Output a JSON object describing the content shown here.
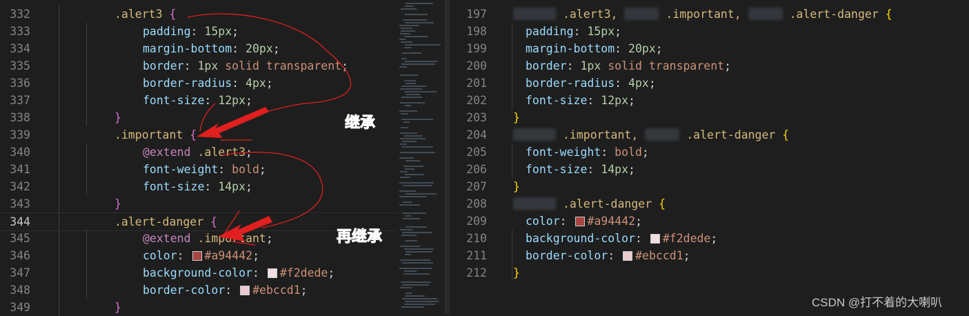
{
  "left_editor": {
    "current_line": 344,
    "lines": [
      {
        "n": "332",
        "indent": 1,
        "tokens": [
          [
            ".alert3 ",
            "sel"
          ],
          [
            "{",
            "bo"
          ]
        ]
      },
      {
        "n": "333",
        "indent": 2,
        "tokens": [
          [
            "padding",
            "prop"
          ],
          [
            ": ",
            "p"
          ],
          [
            "15px",
            "num"
          ],
          [
            ";",
            "p"
          ]
        ]
      },
      {
        "n": "334",
        "indent": 2,
        "tokens": [
          [
            "margin-bottom",
            "prop"
          ],
          [
            ": ",
            "p"
          ],
          [
            "20px",
            "num"
          ],
          [
            ";",
            "p"
          ]
        ]
      },
      {
        "n": "335",
        "indent": 2,
        "tokens": [
          [
            "border",
            "prop"
          ],
          [
            ": ",
            "p"
          ],
          [
            "1px",
            "num"
          ],
          [
            " solid transparent",
            "str"
          ],
          [
            ";",
            "p"
          ]
        ]
      },
      {
        "n": "336",
        "indent": 2,
        "tokens": [
          [
            "border-radius",
            "prop"
          ],
          [
            ": ",
            "p"
          ],
          [
            "4px",
            "num"
          ],
          [
            ";",
            "p"
          ]
        ]
      },
      {
        "n": "337",
        "indent": 2,
        "tokens": [
          [
            "font-size",
            "prop"
          ],
          [
            ": ",
            "p"
          ],
          [
            "12px",
            "num"
          ],
          [
            ";",
            "p"
          ]
        ]
      },
      {
        "n": "338",
        "indent": 1,
        "tokens": [
          [
            "}",
            "bo"
          ]
        ]
      },
      {
        "n": "339",
        "indent": 1,
        "tokens": [
          [
            ".important ",
            "sel"
          ],
          [
            "{",
            "bo"
          ]
        ]
      },
      {
        "n": "340",
        "indent": 2,
        "tokens": [
          [
            "@extend",
            "at"
          ],
          [
            " .alert3",
            "sel"
          ],
          [
            ";",
            "p"
          ]
        ]
      },
      {
        "n": "341",
        "indent": 2,
        "tokens": [
          [
            "font-weight",
            "prop"
          ],
          [
            ": ",
            "p"
          ],
          [
            "bold",
            "str"
          ],
          [
            ";",
            "p"
          ]
        ]
      },
      {
        "n": "342",
        "indent": 2,
        "tokens": [
          [
            "font-size",
            "prop"
          ],
          [
            ": ",
            "p"
          ],
          [
            "14px",
            "num"
          ],
          [
            ";",
            "p"
          ]
        ]
      },
      {
        "n": "343",
        "indent": 1,
        "tokens": [
          [
            "}",
            "bo"
          ]
        ]
      },
      {
        "n": "344",
        "indent": 1,
        "tokens": [
          [
            ".alert-danger ",
            "sel"
          ],
          [
            "{",
            "bo"
          ]
        ]
      },
      {
        "n": "345",
        "indent": 2,
        "tokens": [
          [
            "@extend",
            "at"
          ],
          [
            " .important",
            "sel"
          ],
          [
            ";",
            "p"
          ]
        ]
      },
      {
        "n": "346",
        "indent": 2,
        "tokens": [
          [
            "color",
            "prop"
          ],
          [
            ": ",
            "p"
          ],
          [
            "#a94442",
            "swatch"
          ],
          [
            "#a94442",
            "str"
          ],
          [
            ";",
            "p"
          ]
        ]
      },
      {
        "n": "347",
        "indent": 2,
        "tokens": [
          [
            "background-color",
            "prop"
          ],
          [
            ": ",
            "p"
          ],
          [
            "#f2dede",
            "swatch"
          ],
          [
            "#f2dede",
            "str"
          ],
          [
            ";",
            "p"
          ]
        ]
      },
      {
        "n": "348",
        "indent": 2,
        "tokens": [
          [
            "border-color",
            "prop"
          ],
          [
            ": ",
            "p"
          ],
          [
            "#ebccd1",
            "swatch"
          ],
          [
            "#ebccd1",
            "str"
          ],
          [
            ";",
            "p"
          ]
        ]
      },
      {
        "n": "349",
        "indent": 1,
        "tokens": [
          [
            "}",
            "bo"
          ]
        ]
      }
    ]
  },
  "right_editor": {
    "lines": [
      {
        "n": "197",
        "indent": 0,
        "tokens": [
          [
            "",
            "blur"
          ],
          [
            ".alert3, ",
            "sel"
          ],
          [
            "",
            "blur"
          ],
          [
            ".important, ",
            "sel"
          ],
          [
            "",
            "blur"
          ],
          [
            ".alert-danger ",
            "sel"
          ],
          [
            "{",
            "by"
          ]
        ]
      },
      {
        "n": "198",
        "indent": 1,
        "tokens": [
          [
            "padding",
            "prop"
          ],
          [
            ": ",
            "p"
          ],
          [
            "15px",
            "num"
          ],
          [
            ";",
            "p"
          ]
        ]
      },
      {
        "n": "199",
        "indent": 1,
        "tokens": [
          [
            "margin-bottom",
            "prop"
          ],
          [
            ": ",
            "p"
          ],
          [
            "20px",
            "num"
          ],
          [
            ";",
            "p"
          ]
        ]
      },
      {
        "n": "200",
        "indent": 1,
        "tokens": [
          [
            "border",
            "prop"
          ],
          [
            ": ",
            "p"
          ],
          [
            "1px",
            "num"
          ],
          [
            " solid transparent",
            "str"
          ],
          [
            ";",
            "p"
          ]
        ]
      },
      {
        "n": "201",
        "indent": 1,
        "tokens": [
          [
            "border-radius",
            "prop"
          ],
          [
            ": ",
            "p"
          ],
          [
            "4px",
            "num"
          ],
          [
            ";",
            "p"
          ]
        ]
      },
      {
        "n": "202",
        "indent": 1,
        "tokens": [
          [
            "font-size",
            "prop"
          ],
          [
            ": ",
            "p"
          ],
          [
            "12px",
            "num"
          ],
          [
            ";",
            "p"
          ]
        ]
      },
      {
        "n": "203",
        "indent": 0,
        "tokens": [
          [
            "}",
            "by"
          ]
        ]
      },
      {
        "n": "204",
        "indent": 0,
        "tokens": [
          [
            "",
            "blur"
          ],
          [
            ".important, ",
            "sel"
          ],
          [
            "",
            "blur"
          ],
          [
            ".alert-danger ",
            "sel"
          ],
          [
            "{",
            "by"
          ]
        ]
      },
      {
        "n": "205",
        "indent": 1,
        "tokens": [
          [
            "font-weight",
            "prop"
          ],
          [
            ": ",
            "p"
          ],
          [
            "bold",
            "str"
          ],
          [
            ";",
            "p"
          ]
        ]
      },
      {
        "n": "206",
        "indent": 1,
        "tokens": [
          [
            "font-size",
            "prop"
          ],
          [
            ": ",
            "p"
          ],
          [
            "14px",
            "num"
          ],
          [
            ";",
            "p"
          ]
        ]
      },
      {
        "n": "207",
        "indent": 0,
        "tokens": [
          [
            "}",
            "by"
          ]
        ]
      },
      {
        "n": "208",
        "indent": 0,
        "tokens": [
          [
            "",
            "blur"
          ],
          [
            ".alert-danger ",
            "sel"
          ],
          [
            "{",
            "by"
          ]
        ]
      },
      {
        "n": "209",
        "indent": 1,
        "tokens": [
          [
            "color",
            "prop"
          ],
          [
            ": ",
            "p"
          ],
          [
            "#a94442",
            "swatch"
          ],
          [
            "#a94442",
            "str"
          ],
          [
            ";",
            "p"
          ]
        ]
      },
      {
        "n": "210",
        "indent": 1,
        "tokens": [
          [
            "background-color",
            "prop"
          ],
          [
            ": ",
            "p"
          ],
          [
            "#f2dede",
            "swatch"
          ],
          [
            "#f2dede",
            "str"
          ],
          [
            ";",
            "p"
          ]
        ]
      },
      {
        "n": "211",
        "indent": 1,
        "tokens": [
          [
            "border-color",
            "prop"
          ],
          [
            ": ",
            "p"
          ],
          [
            "#ebccd1",
            "swatch"
          ],
          [
            "#ebccd1",
            "str"
          ],
          [
            ";",
            "p"
          ]
        ]
      },
      {
        "n": "212",
        "indent": 0,
        "tokens": [
          [
            "}",
            "by"
          ]
        ]
      }
    ]
  },
  "annotations": {
    "inherit": "继承",
    "inherit_again": "再继承",
    "color": "#e8201f"
  },
  "watermark": "CSDN @打不着的大喇叭"
}
